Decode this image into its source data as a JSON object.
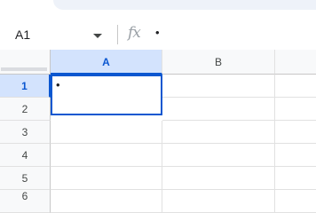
{
  "name_box": {
    "cell_ref": "A1"
  },
  "formula_bar": {
    "fx_label": "fx",
    "content": "•"
  },
  "columns": [
    "A",
    "B"
  ],
  "rows": [
    "1",
    "2",
    "3",
    "4",
    "5",
    "6"
  ],
  "selection": {
    "column": "A",
    "row": "1"
  },
  "cells": {
    "A1": "•"
  },
  "colors": {
    "selection": "#0b57d0",
    "header_selected_bg": "#d3e3fd"
  }
}
